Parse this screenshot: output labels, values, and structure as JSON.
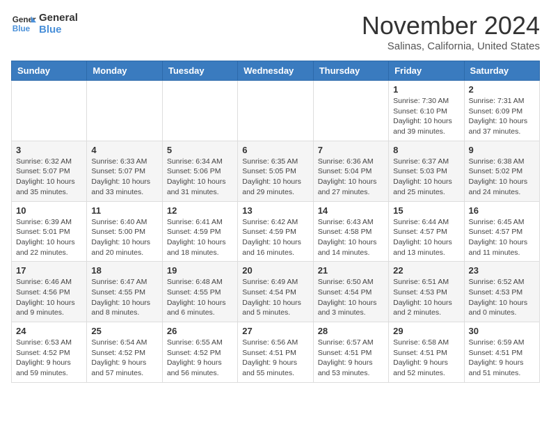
{
  "header": {
    "logo_line1": "General",
    "logo_line2": "Blue",
    "month": "November 2024",
    "location": "Salinas, California, United States"
  },
  "weekdays": [
    "Sunday",
    "Monday",
    "Tuesday",
    "Wednesday",
    "Thursday",
    "Friday",
    "Saturday"
  ],
  "weeks": [
    [
      {
        "day": "",
        "info": ""
      },
      {
        "day": "",
        "info": ""
      },
      {
        "day": "",
        "info": ""
      },
      {
        "day": "",
        "info": ""
      },
      {
        "day": "",
        "info": ""
      },
      {
        "day": "1",
        "info": "Sunrise: 7:30 AM\nSunset: 6:10 PM\nDaylight: 10 hours\nand 39 minutes."
      },
      {
        "day": "2",
        "info": "Sunrise: 7:31 AM\nSunset: 6:09 PM\nDaylight: 10 hours\nand 37 minutes."
      }
    ],
    [
      {
        "day": "3",
        "info": "Sunrise: 6:32 AM\nSunset: 5:07 PM\nDaylight: 10 hours\nand 35 minutes."
      },
      {
        "day": "4",
        "info": "Sunrise: 6:33 AM\nSunset: 5:07 PM\nDaylight: 10 hours\nand 33 minutes."
      },
      {
        "day": "5",
        "info": "Sunrise: 6:34 AM\nSunset: 5:06 PM\nDaylight: 10 hours\nand 31 minutes."
      },
      {
        "day": "6",
        "info": "Sunrise: 6:35 AM\nSunset: 5:05 PM\nDaylight: 10 hours\nand 29 minutes."
      },
      {
        "day": "7",
        "info": "Sunrise: 6:36 AM\nSunset: 5:04 PM\nDaylight: 10 hours\nand 27 minutes."
      },
      {
        "day": "8",
        "info": "Sunrise: 6:37 AM\nSunset: 5:03 PM\nDaylight: 10 hours\nand 25 minutes."
      },
      {
        "day": "9",
        "info": "Sunrise: 6:38 AM\nSunset: 5:02 PM\nDaylight: 10 hours\nand 24 minutes."
      }
    ],
    [
      {
        "day": "10",
        "info": "Sunrise: 6:39 AM\nSunset: 5:01 PM\nDaylight: 10 hours\nand 22 minutes."
      },
      {
        "day": "11",
        "info": "Sunrise: 6:40 AM\nSunset: 5:00 PM\nDaylight: 10 hours\nand 20 minutes."
      },
      {
        "day": "12",
        "info": "Sunrise: 6:41 AM\nSunset: 4:59 PM\nDaylight: 10 hours\nand 18 minutes."
      },
      {
        "day": "13",
        "info": "Sunrise: 6:42 AM\nSunset: 4:59 PM\nDaylight: 10 hours\nand 16 minutes."
      },
      {
        "day": "14",
        "info": "Sunrise: 6:43 AM\nSunset: 4:58 PM\nDaylight: 10 hours\nand 14 minutes."
      },
      {
        "day": "15",
        "info": "Sunrise: 6:44 AM\nSunset: 4:57 PM\nDaylight: 10 hours\nand 13 minutes."
      },
      {
        "day": "16",
        "info": "Sunrise: 6:45 AM\nSunset: 4:57 PM\nDaylight: 10 hours\nand 11 minutes."
      }
    ],
    [
      {
        "day": "17",
        "info": "Sunrise: 6:46 AM\nSunset: 4:56 PM\nDaylight: 10 hours\nand 9 minutes."
      },
      {
        "day": "18",
        "info": "Sunrise: 6:47 AM\nSunset: 4:55 PM\nDaylight: 10 hours\nand 8 minutes."
      },
      {
        "day": "19",
        "info": "Sunrise: 6:48 AM\nSunset: 4:55 PM\nDaylight: 10 hours\nand 6 minutes."
      },
      {
        "day": "20",
        "info": "Sunrise: 6:49 AM\nSunset: 4:54 PM\nDaylight: 10 hours\nand 5 minutes."
      },
      {
        "day": "21",
        "info": "Sunrise: 6:50 AM\nSunset: 4:54 PM\nDaylight: 10 hours\nand 3 minutes."
      },
      {
        "day": "22",
        "info": "Sunrise: 6:51 AM\nSunset: 4:53 PM\nDaylight: 10 hours\nand 2 minutes."
      },
      {
        "day": "23",
        "info": "Sunrise: 6:52 AM\nSunset: 4:53 PM\nDaylight: 10 hours\nand 0 minutes."
      }
    ],
    [
      {
        "day": "24",
        "info": "Sunrise: 6:53 AM\nSunset: 4:52 PM\nDaylight: 9 hours\nand 59 minutes."
      },
      {
        "day": "25",
        "info": "Sunrise: 6:54 AM\nSunset: 4:52 PM\nDaylight: 9 hours\nand 57 minutes."
      },
      {
        "day": "26",
        "info": "Sunrise: 6:55 AM\nSunset: 4:52 PM\nDaylight: 9 hours\nand 56 minutes."
      },
      {
        "day": "27",
        "info": "Sunrise: 6:56 AM\nSunset: 4:51 PM\nDaylight: 9 hours\nand 55 minutes."
      },
      {
        "day": "28",
        "info": "Sunrise: 6:57 AM\nSunset: 4:51 PM\nDaylight: 9 hours\nand 53 minutes."
      },
      {
        "day": "29",
        "info": "Sunrise: 6:58 AM\nSunset: 4:51 PM\nDaylight: 9 hours\nand 52 minutes."
      },
      {
        "day": "30",
        "info": "Sunrise: 6:59 AM\nSunset: 4:51 PM\nDaylight: 9 hours\nand 51 minutes."
      }
    ]
  ]
}
